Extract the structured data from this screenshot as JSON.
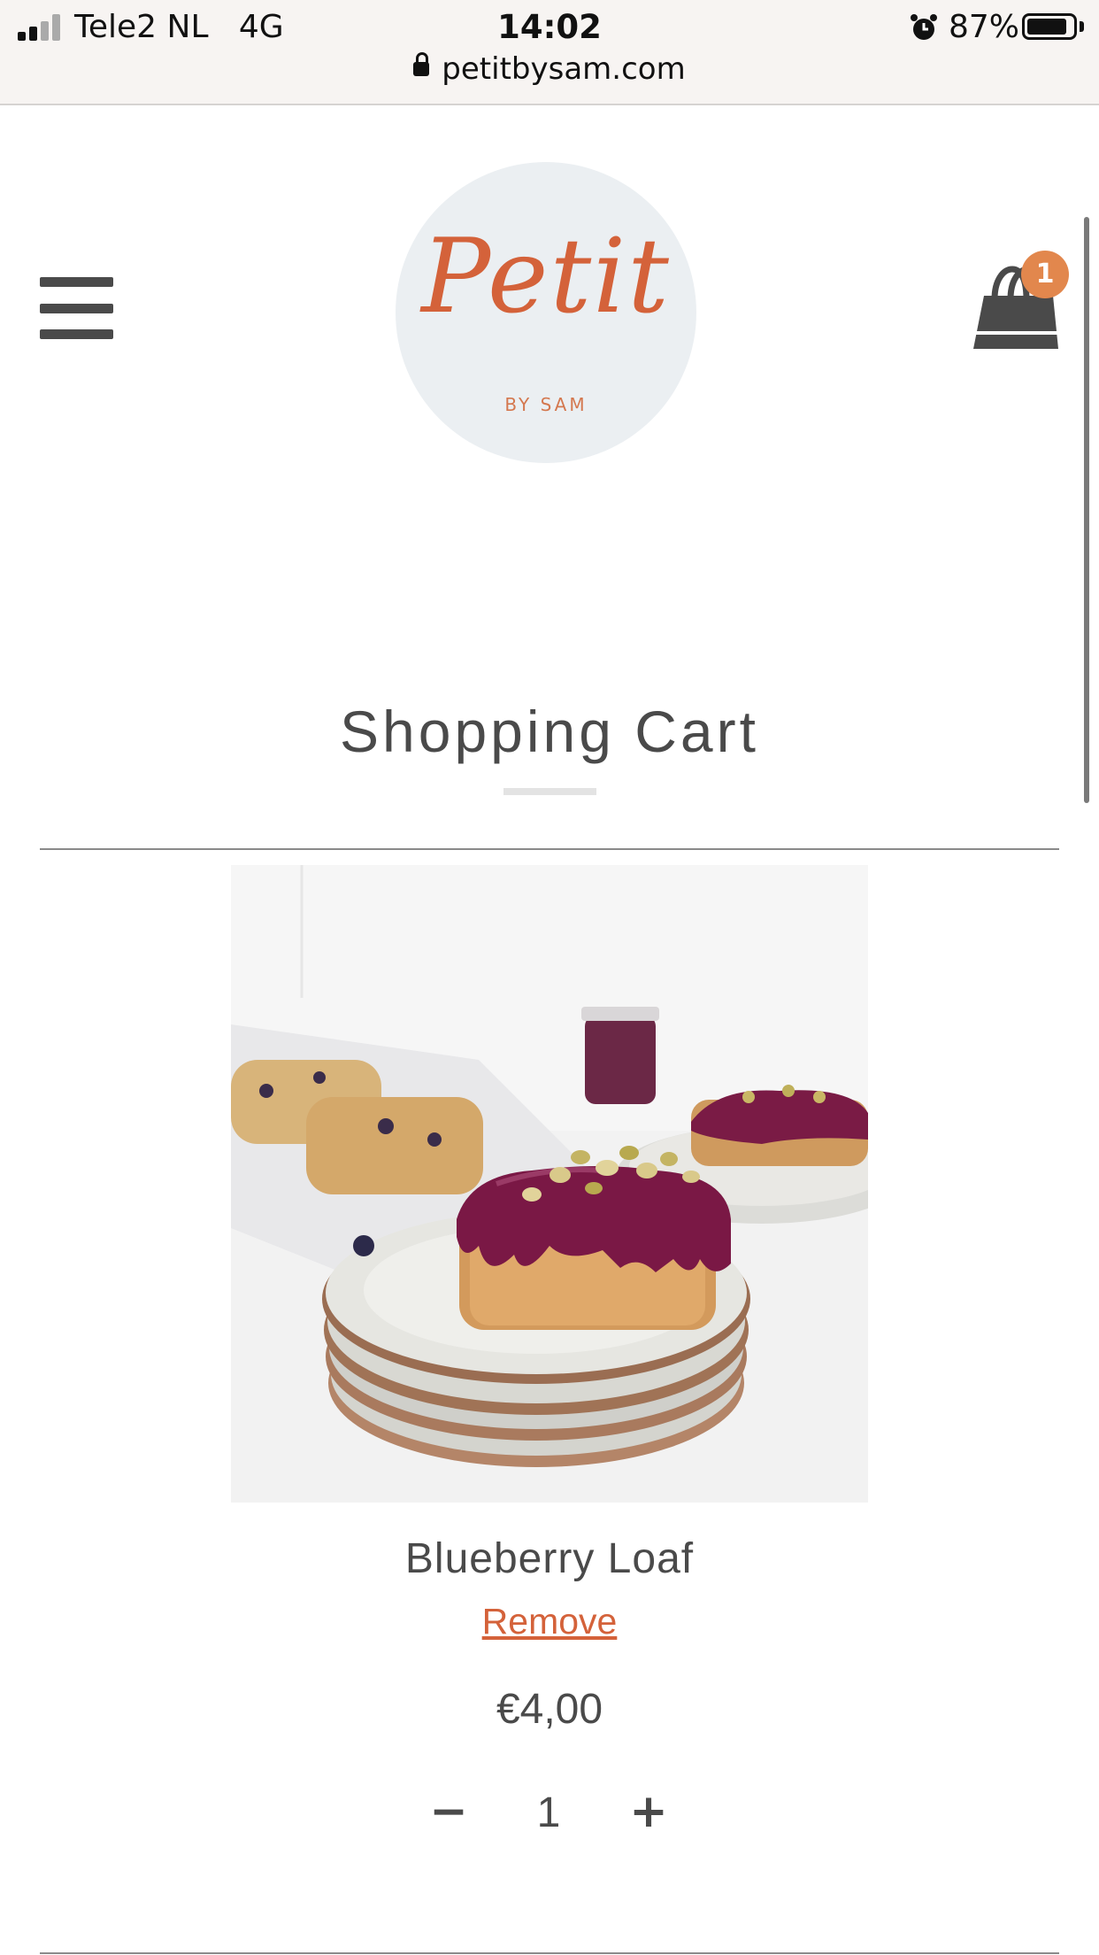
{
  "status_bar": {
    "carrier": "Tele2 NL   4G",
    "time": "14:02",
    "battery_percent": "87%",
    "battery_level": 0.87,
    "icons": [
      "signal-icon",
      "alarm-icon",
      "battery-icon"
    ]
  },
  "browser": {
    "url": "petitbysam.com",
    "icon": "lock-icon"
  },
  "header": {
    "logo_script": "Petit",
    "logo_subtitle": "BY SAM",
    "menu_icon": "hamburger-menu-icon",
    "cart_icon": "shopping-bag-icon",
    "cart_count": "1"
  },
  "page": {
    "title": "Shopping Cart"
  },
  "cart": {
    "items": [
      {
        "name": "Blueberry Loaf",
        "remove_label": "Remove",
        "price": "€4,00",
        "quantity": "1",
        "decrement_label": "−",
        "increment_label": "+"
      }
    ]
  },
  "colors": {
    "accent": "#d4623a",
    "badge": "#e2874d",
    "logo_bg": "#ebeff2",
    "text": "#4a4a4a"
  }
}
